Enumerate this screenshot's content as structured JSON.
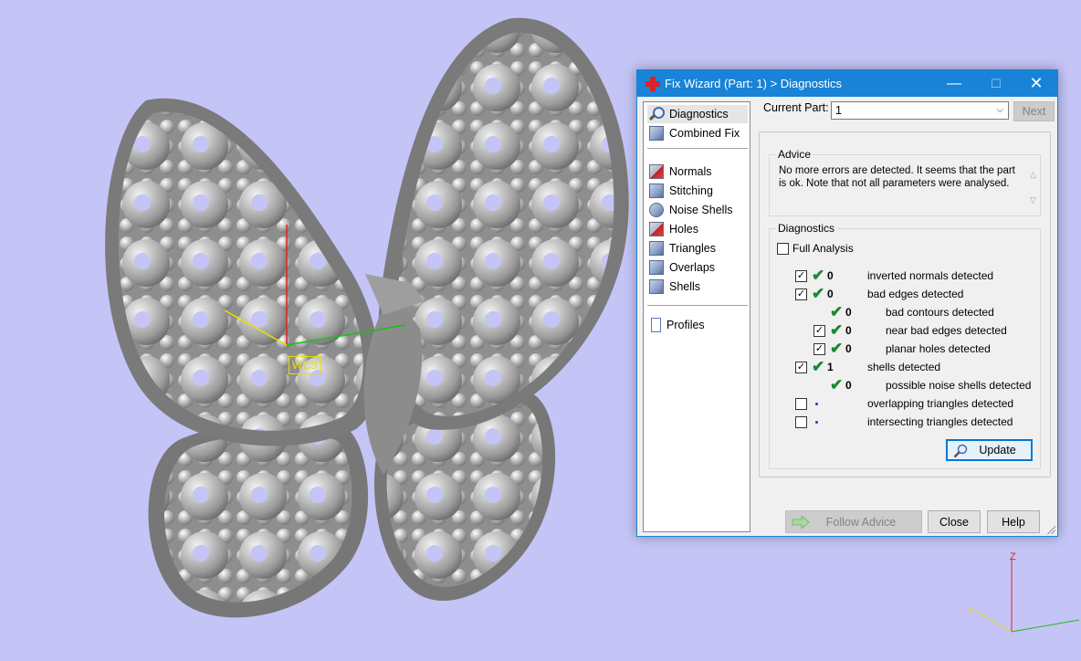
{
  "viewport": {
    "background": "#c4c4f6",
    "wcs_label": "WCS",
    "axis_z_label": "Z",
    "axis_y_label": "Y"
  },
  "dialog": {
    "title": "Fix Wizard (Part: 1) > Diagnostics",
    "window_buttons": {
      "minimize": "—",
      "maximize": "☐",
      "close": "✕"
    },
    "sidebar": {
      "items": [
        {
          "label": "Diagnostics",
          "icon": "magnifier-icon"
        },
        {
          "label": "Combined Fix",
          "icon": "cube-stack-icon"
        },
        {
          "label": "Normals",
          "icon": "normals-cube-icon"
        },
        {
          "label": "Stitching",
          "icon": "stitching-cube-icon"
        },
        {
          "label": "Noise Shells",
          "icon": "noise-shells-icon"
        },
        {
          "label": "Holes",
          "icon": "holes-cube-icon"
        },
        {
          "label": "Triangles",
          "icon": "triangles-cube-icon"
        },
        {
          "label": "Overlaps",
          "icon": "overlaps-cube-icon"
        },
        {
          "label": "Shells",
          "icon": "shells-cube-icon"
        },
        {
          "label": "Profiles",
          "icon": "document-icon"
        }
      ]
    },
    "current_part_label": "Current Part:",
    "current_part_value": "1",
    "next_button": "Next",
    "advice": {
      "title": "Advice",
      "text": "No more errors are detected. It seems that the part is ok. Note that not all parameters were analysed."
    },
    "diagnostics": {
      "title": "Diagnostics",
      "full_analysis_label": "Full Analysis",
      "full_analysis_checked": false,
      "rows": [
        {
          "checked": true,
          "status": "ok",
          "count": "0",
          "label": "inverted normals detected"
        },
        {
          "checked": true,
          "status": "ok",
          "count": "0",
          "label": "bad edges detected"
        },
        {
          "checked": null,
          "status": "ok",
          "count": "0",
          "label": "bad contours detected"
        },
        {
          "checked": true,
          "status": "ok",
          "count": "0",
          "label": "near bad edges detected"
        },
        {
          "checked": true,
          "status": "ok",
          "count": "0",
          "label": "planar holes detected"
        },
        {
          "checked": true,
          "status": "ok",
          "count": "1",
          "label": "shells detected"
        },
        {
          "checked": null,
          "status": "ok",
          "count": "0",
          "label": "possible noise shells detected"
        },
        {
          "checked": false,
          "status": "not-run",
          "count": "",
          "label": "overlapping triangles detected"
        },
        {
          "checked": false,
          "status": "not-run",
          "count": "",
          "label": "intersecting triangles detected"
        }
      ],
      "update_button": "Update"
    },
    "footer": {
      "follow_advice": "Follow Advice",
      "close": "Close",
      "help": "Help"
    },
    "colors": {
      "titlebar": "#1883d7",
      "tick_green": "#1b8a2f"
    }
  }
}
